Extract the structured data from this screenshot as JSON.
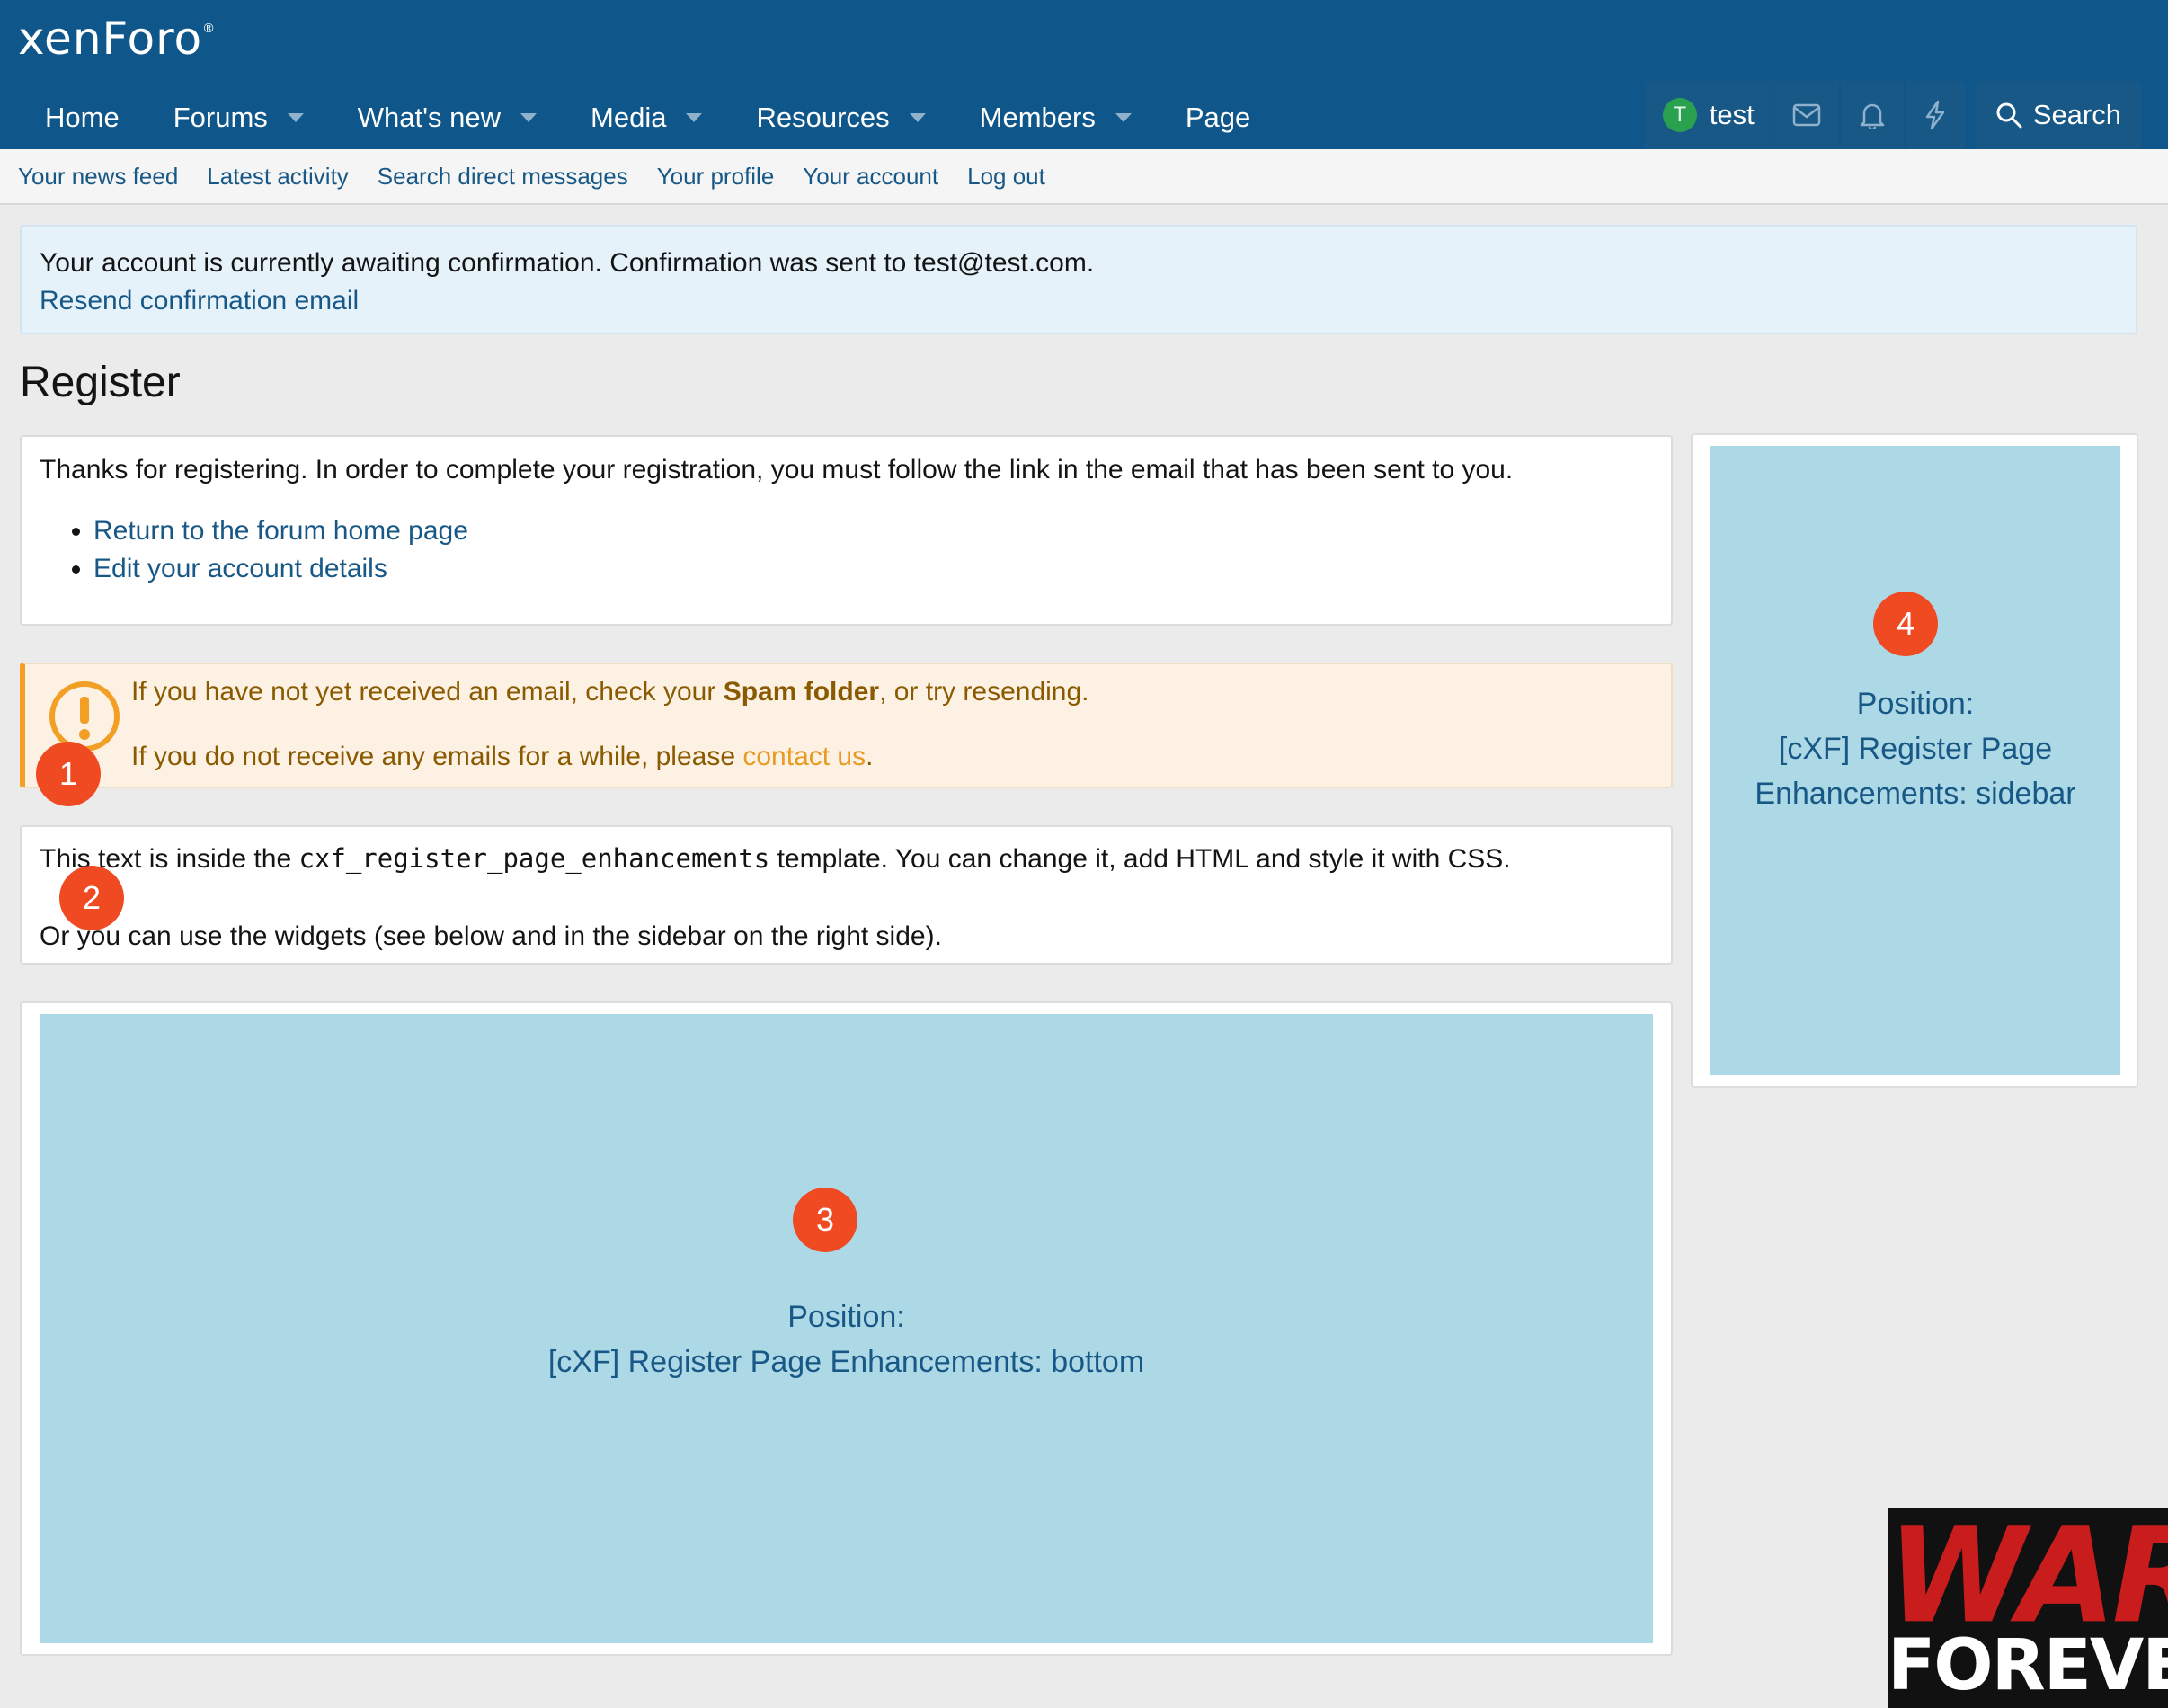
{
  "header": {
    "logo": "xenForo",
    "nav": [
      {
        "label": "Home",
        "caret": false
      },
      {
        "label": "Forums",
        "caret": true
      },
      {
        "label": "What's new",
        "caret": true
      },
      {
        "label": "Media",
        "caret": true
      },
      {
        "label": "Resources",
        "caret": true
      },
      {
        "label": "Members",
        "caret": true
      },
      {
        "label": "Page",
        "caret": false
      }
    ],
    "user": {
      "initial": "T",
      "name": "test"
    },
    "search_label": "Search"
  },
  "subnav": [
    "Your news feed",
    "Latest activity",
    "Search direct messages",
    "Your profile",
    "Your account",
    "Log out"
  ],
  "notice": {
    "text": "Your account is currently awaiting confirmation. Confirmation was sent to test@test.com.",
    "link": "Resend confirmation email"
  },
  "page_title": "Register",
  "thanks": {
    "text": "Thanks for registering. In order to complete your registration, you must follow the link in the email that has been sent to you.",
    "links": [
      "Return to the forum home page",
      "Edit your account details"
    ]
  },
  "warning": {
    "line1_pre": "If you have not yet received an email, check your ",
    "line1_bold": "Spam folder",
    "line1_post": ", or try resending.",
    "line2_pre": "If you do not receive any emails for a while, please ",
    "line2_link": "contact us",
    "line2_post": "."
  },
  "template_block": {
    "p1_pre": "This text is inside the ",
    "p1_code": "cxf_register_page_enhancements",
    "p1_post": " template. You can change it, add HTML and style it with CSS.",
    "p2": "Or you can use the widgets (see below and in the sidebar on the right side)."
  },
  "widget_bottom": {
    "line1": "Position:",
    "line2": "[cXF] Register Page Enhancements: bottom"
  },
  "widget_sidebar": {
    "line1": "Position:",
    "line2": "[cXF] Register Page",
    "line3": "Enhancements: sidebar"
  },
  "badges": [
    "1",
    "2",
    "3",
    "4"
  ],
  "watermark": {
    "top": "WAR",
    "bottom": "FOREVER"
  },
  "colors": {
    "header": "#0f578a",
    "link": "#185886",
    "widget": "#add8e6",
    "badge": "#f04a23",
    "warning_accent": "#f19f25"
  }
}
